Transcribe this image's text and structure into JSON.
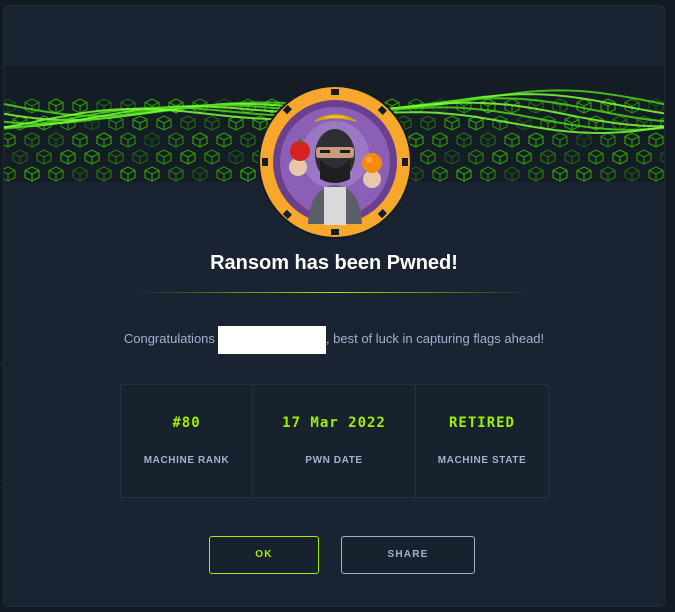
{
  "modal": {
    "title": "Ransom has been Pwned!",
    "congrats_before": "Congratulations",
    "congrats_after": ", best of luck in capturing flags ahead!"
  },
  "stats": [
    {
      "value": "#80",
      "label": "MACHINE RANK"
    },
    {
      "value": "17 Mar 2022",
      "label": "PWN DATE"
    },
    {
      "value": "RETIRED",
      "label": "MACHINE STATE"
    }
  ],
  "actions": {
    "ok_label": "OK",
    "share_label": "SHARE"
  },
  "colors": {
    "accent": "#9fef00",
    "avatar_ring": "#f7a72c",
    "modal_bg": "#1a2332",
    "text_muted": "#a4b1cd"
  },
  "icons": {
    "banner": "green-wave-cubes-banner",
    "avatar": "ninja-juggling-fruit-avatar"
  }
}
